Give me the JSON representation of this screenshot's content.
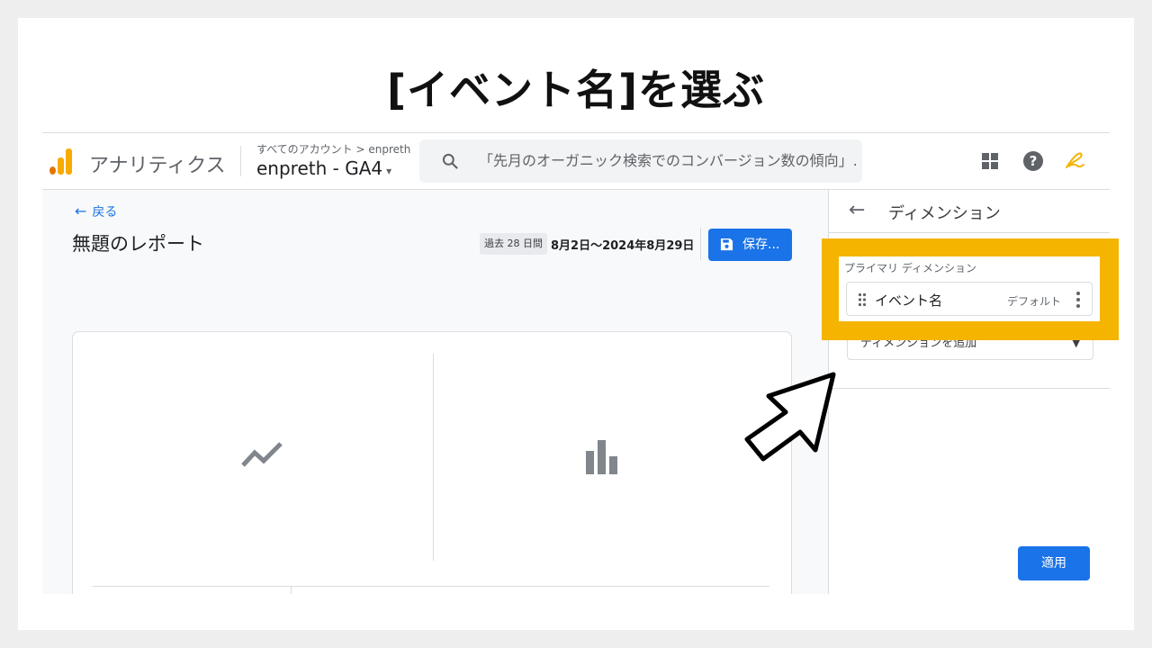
{
  "slide": {
    "title": "[イベント名]を選ぶ"
  },
  "header": {
    "product_name": "アナリティクス",
    "breadcrumb": "すべてのアカウント > enpreth",
    "account_name": "enpreth - GA4",
    "account_caret": "▾",
    "search_placeholder": "「先月のオーガニック検索でのコンバージョン数の傾向」..."
  },
  "main": {
    "back_arrow": "←",
    "back_label": "戻る",
    "report_title": "無題のレポート",
    "date_chip": "過去 28 日間",
    "date_range": "8月2日～2024年8月29日",
    "save_label": "保存..."
  },
  "panel": {
    "back_arrow": "←",
    "title": "ディメンション",
    "primary_label": "プライマリ ディメンション",
    "dimension_chip": "イベント名",
    "chip_default": "デフォルト",
    "add_dimension": "ディメンションを追加",
    "add_chevron": "▼",
    "apply_label": "適用"
  },
  "colors": {
    "accent": "#1a73e8",
    "highlight": "#f4b400",
    "logo_orange": "#f9ab00"
  }
}
